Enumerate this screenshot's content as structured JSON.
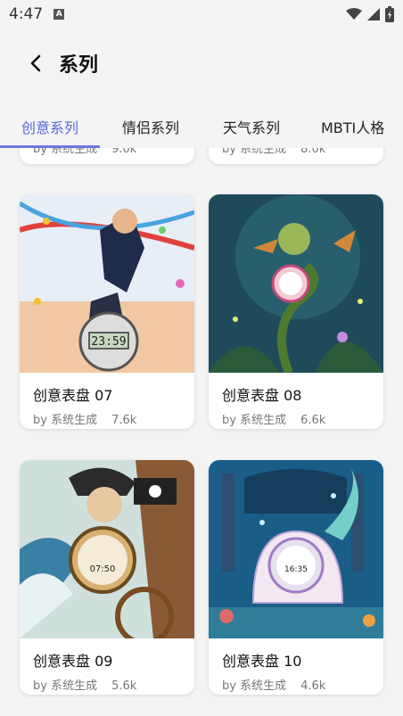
{
  "status": {
    "time": "4:47",
    "notif": "A"
  },
  "header": {
    "title": "系列"
  },
  "tabs": [
    "创意系列",
    "情侣系列",
    "天气系列",
    "MBTI人格"
  ],
  "cards_partial": [
    {
      "by": "by 系统生成",
      "count": "9.0k"
    },
    {
      "by": "by 系统生成",
      "count": "8.0k"
    }
  ],
  "cards": [
    {
      "name": "创意表盘 07",
      "by": "by 系统生成",
      "count": "7.6k",
      "clock_text": "23:59"
    },
    {
      "name": "创意表盘 08",
      "by": "by 系统生成",
      "count": "6.6k",
      "clock_text": ""
    },
    {
      "name": "创意表盘 09",
      "by": "by 系统生成",
      "count": "5.6k",
      "clock_text": "07:50"
    },
    {
      "name": "创意表盘 10",
      "by": "by 系统生成",
      "count": "4.6k",
      "clock_text": "16:35"
    }
  ]
}
